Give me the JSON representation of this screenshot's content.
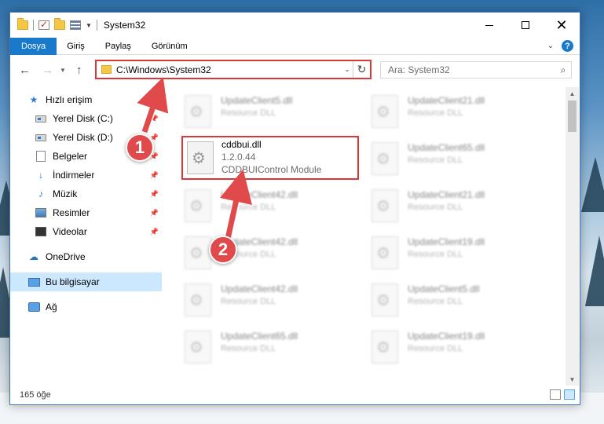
{
  "window": {
    "title": "System32"
  },
  "ribbon": {
    "tabs": [
      "Dosya",
      "Giriş",
      "Paylaş",
      "Görünüm"
    ],
    "help_label": "?"
  },
  "address": {
    "path": "C:\\Windows\\System32",
    "search_placeholder": "Ara: System32"
  },
  "nav": {
    "quick_access": "Hızlı erişim",
    "items": [
      {
        "label": "Yerel Disk (C:)",
        "icon": "drive-icon",
        "pinned": true
      },
      {
        "label": "Yerel Disk (D:)",
        "icon": "drive-icon",
        "pinned": true
      },
      {
        "label": "Belgeler",
        "icon": "documents-icon",
        "pinned": true
      },
      {
        "label": "İndirmeler",
        "icon": "download-icon",
        "pinned": true
      },
      {
        "label": "Müzik",
        "icon": "music-icon",
        "pinned": true
      },
      {
        "label": "Resimler",
        "icon": "pictures-icon",
        "pinned": true
      },
      {
        "label": "Videolar",
        "icon": "videos-icon",
        "pinned": true
      }
    ],
    "onedrive": "OneDrive",
    "this_pc": "Bu bilgisayar",
    "network": "Ağ"
  },
  "content": {
    "selected_file": {
      "name": "cddbui.dll",
      "version": "1.2.0.44",
      "description": "CDDBUIControl Module"
    },
    "files_left": [
      {
        "name": "UpdateClient5.dll",
        "type": "Resource DLL"
      },
      {
        "name": "UpdateClient42.dll",
        "type": "Resource DLL"
      },
      {
        "name": "UpdateClient42.dll",
        "type": "Resource DLL"
      },
      {
        "name": "UpdateClient42.dll",
        "type": "Resource DLL"
      },
      {
        "name": "UpdateClient65.dll",
        "type": "Resource DLL"
      }
    ],
    "files_right": [
      {
        "name": "UpdateClient21.dll",
        "type": "Resource DLL"
      },
      {
        "name": "UpdateClient65.dll",
        "type": "Resource DLL"
      },
      {
        "name": "UpdateClient21.dll",
        "type": "Resource DLL"
      },
      {
        "name": "UpdateClient19.dll",
        "type": "Resource DLL"
      },
      {
        "name": "UpdateClient5.dll",
        "type": "Resource DLL"
      },
      {
        "name": "UpdateClient19.dll",
        "type": "Resource DLL"
      }
    ]
  },
  "status": {
    "item_count": "165 öğe"
  },
  "callouts": [
    "1",
    "2"
  ],
  "colors": {
    "accent": "#1979ca",
    "highlight": "#d93838",
    "callout": "#e04a4a",
    "selection": "#cce8ff"
  }
}
